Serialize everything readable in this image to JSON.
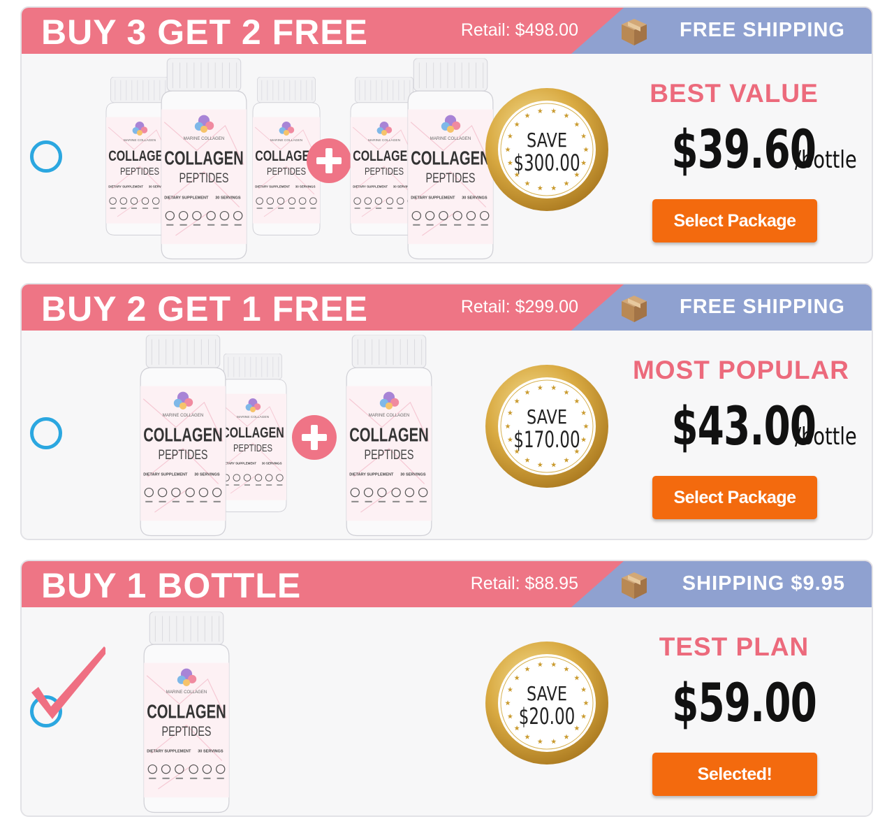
{
  "packages": [
    {
      "title": "BUY 3 GET 2 FREE",
      "retail": "Retail: $498.00",
      "shipping": "FREE  SHIPPING",
      "tagline": "BEST VALUE",
      "price": "$39.60",
      "price_unit": "/bottle",
      "save_label": "SAVE",
      "save_amount": "$300.00",
      "button": "Select Package",
      "selected": false
    },
    {
      "title": "BUY 2 GET 1 FREE",
      "retail": "Retail: $299.00",
      "shipping": "FREE  SHIPPING",
      "tagline": "MOST POPULAR",
      "price": "$43.00",
      "price_unit": "/bottle",
      "save_label": "SAVE",
      "save_amount": "$170.00",
      "button": "Select Package",
      "selected": false
    },
    {
      "title": "BUY 1 BOTTLE",
      "retail": "Retail: $88.95",
      "shipping": "SHIPPING $9.95",
      "tagline": "TEST PLAN",
      "price": "$59.00",
      "price_unit": "",
      "save_label": "SAVE",
      "save_amount": "$20.00",
      "button": "Selected!",
      "selected": true
    }
  ],
  "bottle_label": {
    "brand": "MARINE COLLAGEN",
    "name": "COLLAGEN",
    "subname": "PEPTIDES",
    "supplement": "DIETARY SUPPLEMENT",
    "servings": "30 SERVINGS"
  },
  "icons": {
    "radio": "radio-circle-icon",
    "checkmark": "checkmark-icon",
    "plus": "plus-icon",
    "shipping": "shipping-box-icon",
    "seal": "gold-seal-icon"
  },
  "colors": {
    "header_pink": "#ee7585",
    "shipping_blue": "#8fa1d0",
    "accent_pink": "#ec6a7c",
    "button_orange": "#f36a0e",
    "radio_blue": "#2ba7e0",
    "seal_gold": "#d4a437"
  }
}
